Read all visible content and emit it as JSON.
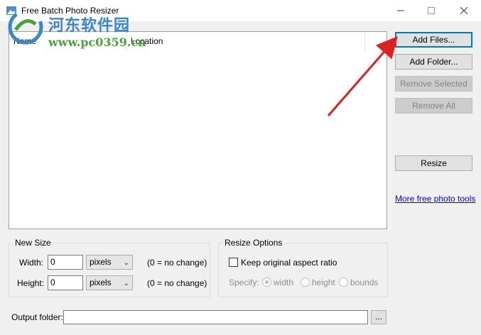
{
  "window": {
    "title": "Free Batch Photo Resizer"
  },
  "watermark": {
    "cn": "河东软件园",
    "url": "www.pc0359.cn"
  },
  "list": {
    "columns": [
      "Name",
      "Location"
    ]
  },
  "buttons": {
    "add_files": "Add Files...",
    "add_folder": "Add Folder...",
    "remove_selected": "Remove Selected",
    "remove_all": "Remove All",
    "resize": "Resize"
  },
  "link": {
    "more_tools": "More free photo tools"
  },
  "new_size": {
    "title": "New Size",
    "width_label": "Width:",
    "width_value": "0",
    "width_unit": "pixels",
    "width_hint": "(0 = no change)",
    "height_label": "Height:",
    "height_value": "0",
    "height_unit": "pixels",
    "height_hint": "(0 = no change)"
  },
  "resize_options": {
    "title": "Resize Options",
    "keep_aspect": "Keep original aspect ratio",
    "keep_aspect_checked": false,
    "specify_label": "Specify:",
    "options": [
      "width",
      "height",
      "bounds"
    ],
    "selected": "width"
  },
  "output": {
    "label": "Output folder:",
    "value": "",
    "browse": "..."
  },
  "colors": {
    "accent": "#0078d7",
    "arrow": "#e02020",
    "link": "#0000ff"
  }
}
